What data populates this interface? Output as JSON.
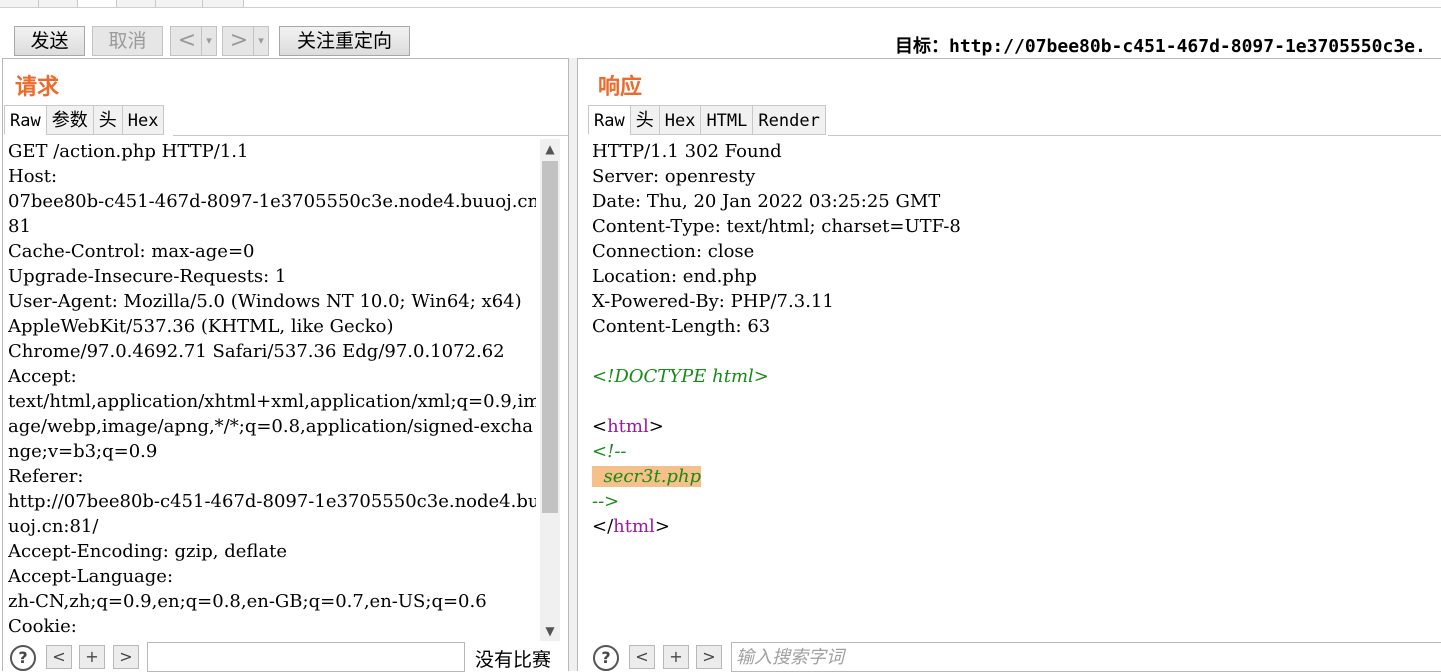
{
  "toolbar": {
    "send_label": "发送",
    "cancel_label": "取消",
    "back_arrow": "<",
    "forward_arrow": ">",
    "dropdown_arrow": "▾",
    "follow_redirect_label": "关注重定向",
    "target_label": "目标：",
    "target_url": "http://07bee80b-c451-467d-8097-1e3705550c3e."
  },
  "request": {
    "title": "请求",
    "tabs": [
      "Raw",
      "参数",
      "头",
      "Hex"
    ],
    "active_tab": "Raw",
    "lines": [
      "GET /action.php HTTP/1.1",
      "Host:",
      "07bee80b-c451-467d-8097-1e3705550c3e.node4.buuoj.cn:",
      "81",
      "Cache-Control: max-age=0",
      "Upgrade-Insecure-Requests: 1",
      "User-Agent: Mozilla/5.0 (Windows NT 10.0; Win64; x64)",
      "AppleWebKit/537.36 (KHTML, like Gecko)",
      "Chrome/97.0.4692.71 Safari/537.36 Edg/97.0.1072.62",
      "Accept:",
      "text/html,application/xhtml+xml,application/xml;q=0.9,im",
      "age/webp,image/apng,*/*;q=0.8,application/signed-excha",
      "nge;v=b3;q=0.9",
      "Referer:",
      "http://07bee80b-c451-467d-8097-1e3705550c3e.node4.bu",
      "uoj.cn:81/",
      "Accept-Encoding: gzip, deflate",
      "Accept-Language:",
      "zh-CN,zh;q=0.9,en;q=0.8,en-GB;q=0.7,en-US;q=0.6",
      "Cookie:"
    ],
    "search_help": "?",
    "search_prev": "<",
    "search_add": "+",
    "search_next": ">",
    "search_value": "",
    "match_status": "没有比赛"
  },
  "response": {
    "title": "响应",
    "tabs": [
      "Raw",
      "头",
      "Hex",
      "HTML",
      "Render"
    ],
    "active_tab": "Raw",
    "headers": [
      "HTTP/1.1 302 Found",
      "Server: openresty",
      "Date: Thu, 20 Jan 2022 03:25:25 GMT",
      "Content-Type: text/html; charset=UTF-8",
      "Connection: close",
      "Location: end.php",
      "X-Powered-By: PHP/7.3.11",
      "Content-Length: 63"
    ],
    "body": {
      "doctype": "<!DOCTYPE html>",
      "html_open_lt": "<",
      "html_tag": "html",
      "html_open_gt": ">",
      "comment_open": "<!--",
      "comment_text": "secr3t.php",
      "comment_close": "-->",
      "html_close_lt": "</",
      "html_close_gt": ">"
    },
    "search_help": "?",
    "search_prev": "<",
    "search_add": "+",
    "search_next": ">",
    "search_placeholder": "输入搜索字词"
  },
  "colors": {
    "title_accent": "#ee6a2b",
    "comment_green": "#198a18",
    "tag_purple": "#9a1aa0",
    "highlight": "#f6c08b"
  }
}
